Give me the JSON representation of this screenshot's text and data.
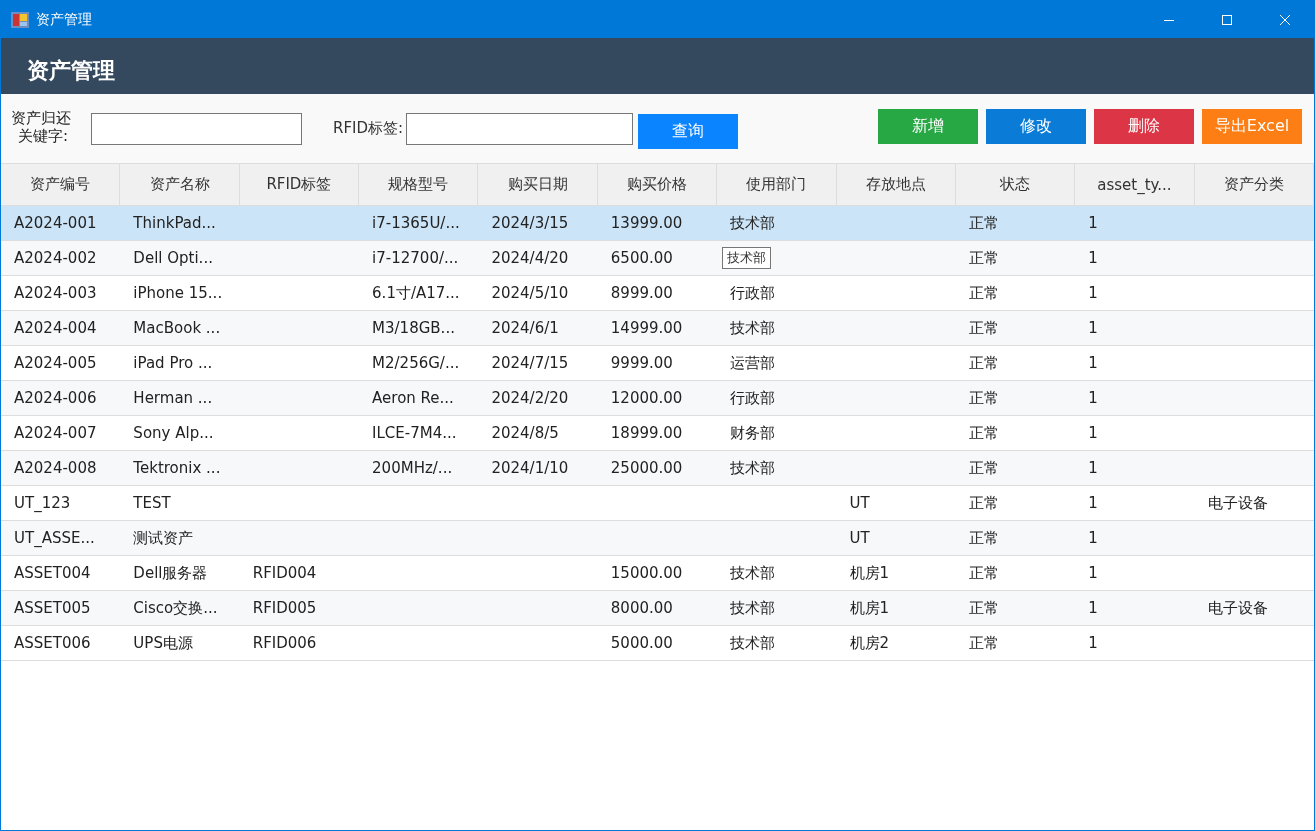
{
  "window": {
    "title": "资产管理"
  },
  "header": {
    "title": "资产管理"
  },
  "toolbar": {
    "label_lines": [
      "资产归还",
      "关键字:"
    ],
    "rfid_label": "RFID标签:",
    "search_button": "查询",
    "actions": [
      {
        "label": "新增",
        "color": "#28a745"
      },
      {
        "label": "修改",
        "color": "#0a7bd6"
      },
      {
        "label": "删除",
        "color": "#dc3545"
      },
      {
        "label": "导出Excel",
        "color": "#fd7e14"
      }
    ]
  },
  "table": {
    "columns": [
      "资产编号",
      "资产名称",
      "RFID标签",
      "规格型号",
      "购买日期",
      "购买价格",
      "使用部门",
      "存放地点",
      "状态",
      "asset_ty...",
      "资产分类"
    ],
    "rows": [
      {
        "selected": true,
        "cells": [
          "A2024-001",
          "ThinkPad...",
          null,
          "i7-1365U/...",
          "2024/3/15",
          "13999.00",
          "技术部",
          null,
          "正常",
          "1",
          null
        ]
      },
      {
        "selected": false,
        "cells": [
          "A2024-002",
          "Dell Opti...",
          null,
          "i7-12700/...",
          "2024/4/20",
          "6500.00",
          {
            "tooltip": "技术部"
          },
          null,
          "正常",
          "1",
          null
        ]
      },
      {
        "selected": false,
        "cells": [
          "A2024-003",
          "iPhone 15...",
          null,
          "6.1寸/A17...",
          "2024/5/10",
          "8999.00",
          "行政部",
          null,
          "正常",
          "1",
          null
        ]
      },
      {
        "selected": false,
        "cells": [
          "A2024-004",
          "MacBook ...",
          null,
          "M3/18GB...",
          "2024/6/1",
          "14999.00",
          "技术部",
          null,
          "正常",
          "1",
          null
        ]
      },
      {
        "selected": false,
        "cells": [
          "A2024-005",
          "iPad Pro ...",
          null,
          "M2/256G/...",
          "2024/7/15",
          "9999.00",
          "运营部",
          null,
          "正常",
          "1",
          null
        ]
      },
      {
        "selected": false,
        "cells": [
          "A2024-006",
          "Herman ...",
          null,
          "Aeron Re...",
          "2024/2/20",
          "12000.00",
          "行政部",
          null,
          "正常",
          "1",
          null
        ]
      },
      {
        "selected": false,
        "cells": [
          "A2024-007",
          "Sony Alp...",
          null,
          "ILCE-7M4...",
          "2024/8/5",
          "18999.00",
          "财务部",
          null,
          "正常",
          "1",
          null
        ]
      },
      {
        "selected": false,
        "cells": [
          "A2024-008",
          "Tektronix ...",
          null,
          "200MHz/...",
          "2024/1/10",
          "25000.00",
          "技术部",
          null,
          "正常",
          "1",
          null
        ]
      },
      {
        "selected": false,
        "cells": [
          "UT_123",
          "TEST",
          null,
          null,
          null,
          null,
          null,
          "UT",
          "正常",
          "1",
          "电子设备"
        ]
      },
      {
        "selected": false,
        "cells": [
          "UT_ASSE...",
          "测试资产",
          null,
          null,
          null,
          null,
          null,
          "UT",
          "正常",
          "1",
          null
        ]
      },
      {
        "selected": false,
        "cells": [
          "ASSET004",
          "Dell服务器",
          "RFID004",
          null,
          null,
          "15000.00",
          "技术部",
          "机房1",
          "正常",
          "1",
          null
        ]
      },
      {
        "selected": false,
        "cells": [
          "ASSET005",
          "Cisco交换...",
          "RFID005",
          null,
          null,
          "8000.00",
          "技术部",
          "机房1",
          "正常",
          "1",
          "电子设备"
        ]
      },
      {
        "selected": false,
        "cells": [
          "ASSET006",
          "UPS电源",
          "RFID006",
          null,
          null,
          "5000.00",
          "技术部",
          "机房2",
          "正常",
          "1",
          null
        ]
      }
    ]
  }
}
